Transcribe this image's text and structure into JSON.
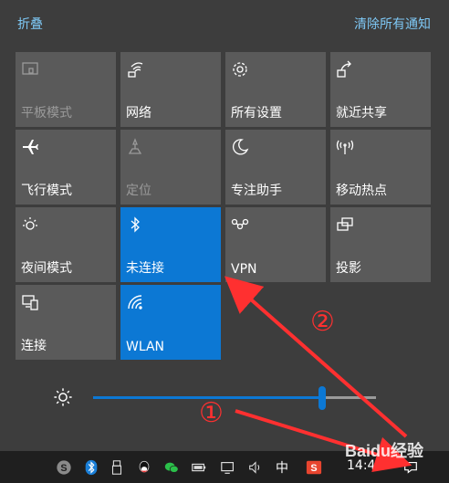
{
  "header": {
    "collapse_label": "折叠",
    "clear_label": "清除所有通知"
  },
  "tiles": [
    {
      "label": "平板模式",
      "icon": "tablet-mode-icon",
      "state": "disabled"
    },
    {
      "label": "网络",
      "icon": "network-icon",
      "state": "off"
    },
    {
      "label": "所有设置",
      "icon": "gear-icon",
      "state": "off"
    },
    {
      "label": "就近共享",
      "icon": "share-icon",
      "state": "off"
    },
    {
      "label": "飞行模式",
      "icon": "airplane-icon",
      "state": "off"
    },
    {
      "label": "定位",
      "icon": "location-icon",
      "state": "disabled"
    },
    {
      "label": "专注助手",
      "icon": "moon-icon",
      "state": "off"
    },
    {
      "label": "移动热点",
      "icon": "hotspot-icon",
      "state": "off"
    },
    {
      "label": "夜间模式",
      "icon": "night-light-icon",
      "state": "off"
    },
    {
      "label": "未连接",
      "icon": "bluetooth-icon",
      "state": "on"
    },
    {
      "label": "VPN",
      "icon": "vpn-icon",
      "state": "off"
    },
    {
      "label": "投影",
      "icon": "project-icon",
      "state": "off"
    },
    {
      "label": "连接",
      "icon": "connect-icon",
      "state": "off"
    },
    {
      "label": "WLAN",
      "icon": "wifi-icon",
      "state": "on"
    }
  ],
  "brightness": {
    "level_percent": 81,
    "icon": "sun-icon"
  },
  "taskbar": {
    "ime_label": "中",
    "time": "14:45",
    "icons": [
      "skype-icon",
      "bluetooth-icon",
      "usb-icon",
      "qq-icon",
      "wechat-icon",
      "battery-icon",
      "network-icon",
      "volume-icon",
      "sogou-icon",
      "notification-icon"
    ]
  },
  "annotations": {
    "marker_1": "①",
    "marker_2": "②",
    "color": "#ff3030"
  },
  "watermark": "Baidu经验"
}
